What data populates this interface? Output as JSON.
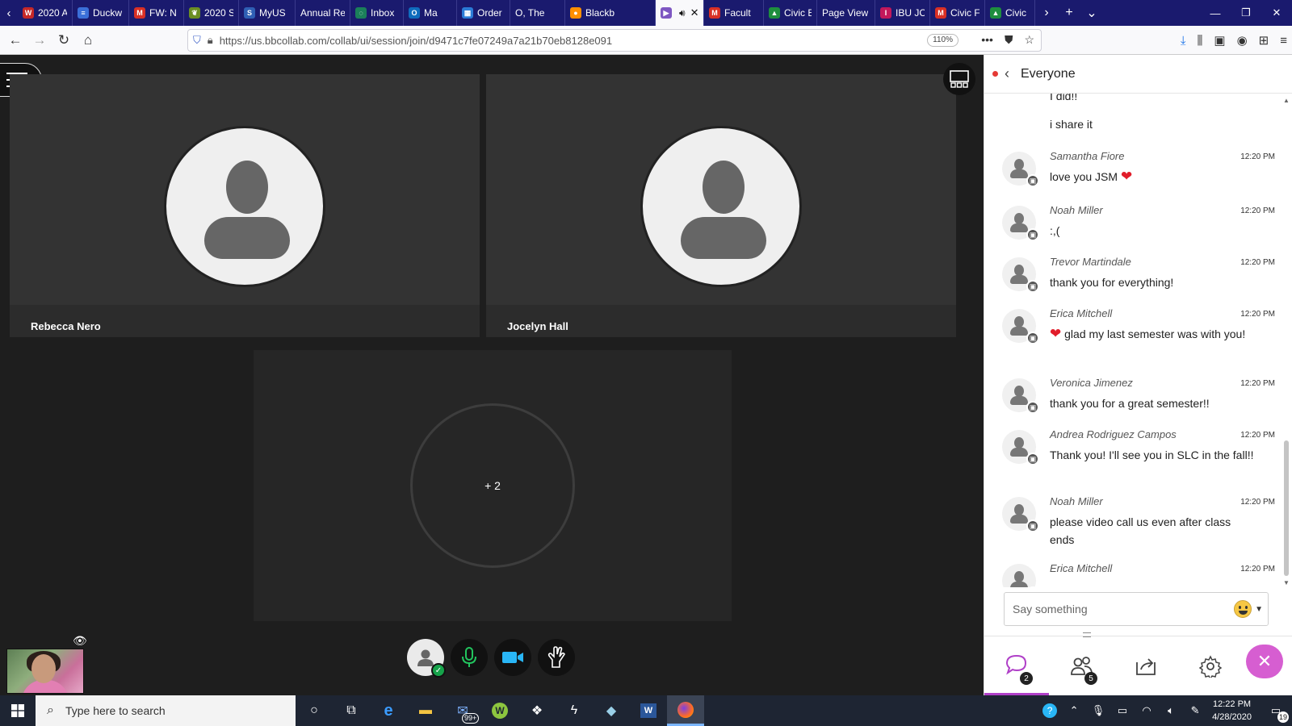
{
  "browser": {
    "tabs": [
      {
        "label": "2020 A",
        "color": "#c62828",
        "glyph": "W"
      },
      {
        "label": "Duckw",
        "color": "#3b6fd8",
        "glyph": "≡"
      },
      {
        "label": "FW: N",
        "color": "#d93025",
        "glyph": "M"
      },
      {
        "label": "2020 S",
        "color": "#6b8e23",
        "glyph": "❦"
      },
      {
        "label": "MyUS",
        "color": "#2f5fb4",
        "glyph": "S"
      },
      {
        "label": "Annual Re",
        "color": "",
        "glyph": ""
      },
      {
        "label": "Inbox",
        "color": "#1b7f5a",
        "glyph": "◌"
      },
      {
        "label": "Ma",
        "color": "#0f6cbd",
        "glyph": "O"
      },
      {
        "label": "Order",
        "color": "#2b7bd6",
        "glyph": "▦"
      },
      {
        "label": "O, The",
        "color": "",
        "glyph": ""
      },
      {
        "label": "Blackb",
        "color": "#ff8f00",
        "glyph": "●"
      },
      {
        "label": "",
        "color": "#7e57c2",
        "glyph": "▶"
      },
      {
        "label": "Facult",
        "color": "#d93025",
        "glyph": "M"
      },
      {
        "label": "Civic E",
        "color": "#1e8e3e",
        "glyph": "▲"
      },
      {
        "label": "Page View",
        "color": "",
        "glyph": ""
      },
      {
        "label": "IBU JC",
        "color": "#c2185b",
        "glyph": "I"
      },
      {
        "label": "Civic F",
        "color": "#d93025",
        "glyph": "M"
      },
      {
        "label": "Civic",
        "color": "#1e8e3e",
        "glyph": "▲"
      }
    ],
    "url": "https://us.bbcollab.com/collab/ui/session/join/d9471c7fe07249a7a21b70eb8128e091",
    "zoom": "110%"
  },
  "session": {
    "participants": [
      {
        "name": "Rebecca Nero"
      },
      {
        "name": "Jocelyn Hall"
      }
    ],
    "overflow_label": "+ 2"
  },
  "chat": {
    "title": "Everyone",
    "partial_lines": [
      "I did!!",
      "i share it"
    ],
    "messages": [
      {
        "author": "Samantha Fiore",
        "time": "12:20 PM",
        "text": "love you JSM",
        "heart": "after"
      },
      {
        "author": "Noah Miller",
        "time": "12:20 PM",
        "text": ":,(",
        "heart": ""
      },
      {
        "author": "Trevor Martindale",
        "time": "12:20 PM",
        "text": "thank you for everything!",
        "heart": ""
      },
      {
        "author": "Erica Mitchell",
        "time": "12:20 PM",
        "text": "glad my last semester was with you!",
        "heart": "before"
      },
      {
        "author": "Veronica Jimenez",
        "time": "12:20 PM",
        "text": "thank you for a great semester!!",
        "heart": ""
      },
      {
        "author": "Andrea Rodriguez Campos",
        "time": "12:20 PM",
        "text": "Thank you! I'll see you in SLC in the fall!!",
        "heart": ""
      },
      {
        "author": "Noah Miller",
        "time": "12:20 PM",
        "text": "please video call us even after class ends",
        "heart": ""
      },
      {
        "author": "Erica Mitchell",
        "time": "12:20 PM",
        "text": "",
        "heart": ""
      }
    ],
    "input_placeholder": "Say something",
    "tab_counts": {
      "chat": "2",
      "attendees": "5"
    }
  },
  "taskbar": {
    "search_placeholder": "Type here to search",
    "mail_badge": "99+",
    "time": "12:22 PM",
    "date": "4/28/2020",
    "notifications": "19"
  },
  "colors": {
    "accent": "#b040c8",
    "close": "#d65ed1",
    "mic": "#22c55e",
    "camera": "#29b6f6"
  }
}
